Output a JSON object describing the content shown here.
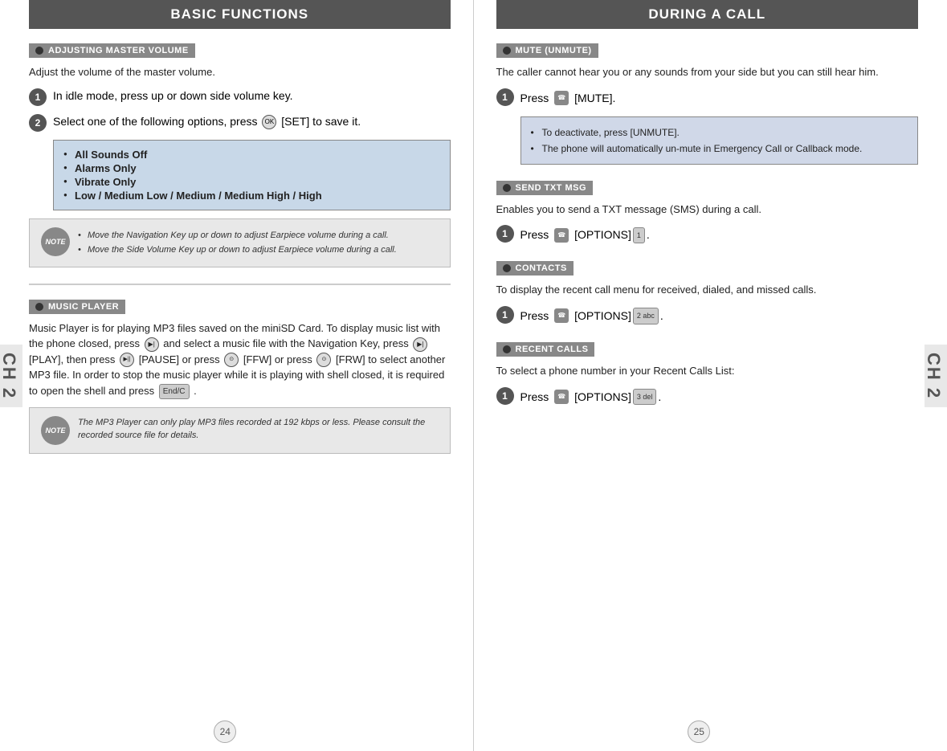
{
  "left": {
    "section_title": "BASIC FUNCTIONS",
    "ch_label": "CH 2",
    "page_number": "24",
    "adjusting_volume": {
      "header": "ADJUSTING MASTER VOLUME",
      "desc": "Adjust the volume of the master volume.",
      "step1": "In idle mode, press up or down side volume key.",
      "step2_prefix": "Select one of the following options, press",
      "step2_suffix": "[SET] to save it.",
      "options": [
        "All Sounds Off",
        "Alarms Only",
        "Vibrate Only",
        "Low / Medium Low / Medium / Medium High / High"
      ],
      "note_items": [
        "Move the Navigation Key up or down to adjust Earpiece volume during a call.",
        "Move the Side Volume Key up or down to adjust Earpiece volume during a call."
      ]
    },
    "music_player": {
      "header": "MUSIC PLAYER",
      "desc": "Music Player is for playing MP3 files saved on the miniSD Card. To display music list with the phone closed, press",
      "desc2": "and select a music file with the Navigation Key, press",
      "desc3": "[PLAY], then press",
      "desc4": "[PAUSE] or press",
      "desc5": "[FFW] or press",
      "desc6": "[FRW] to select another MP3 file. In order to stop the music player while it is playing with shell closed, it is required to open the shell and press",
      "desc7": ".",
      "note_text": "The MP3 Player can only play MP3 files recorded at 192 kbps or less. Please consult the recorded source file for details."
    }
  },
  "right": {
    "section_title": "DURING A CALL",
    "ch_label": "CH 2",
    "page_number": "25",
    "mute": {
      "header": "MUTE (UNMUTE)",
      "desc": "The caller cannot hear you or any sounds from your side but you can still hear him.",
      "step1_prefix": "Press",
      "step1_suffix": "[MUTE].",
      "info_items": [
        "To deactivate, press  [UNMUTE].",
        "The phone will automatically un-mute in Emergency Call or Callback mode."
      ]
    },
    "send_txt": {
      "header": "SEND TXT MSG",
      "desc": "Enables you to send a TXT message (SMS) during a call.",
      "step1_prefix": "Press",
      "step1_suffix": "[OPTIONS]"
    },
    "contacts": {
      "header": "CONTACTS",
      "desc": "To display the recent call menu for received, dialed, and missed calls.",
      "step1_prefix": "Press",
      "step1_suffix": "[OPTIONS]"
    },
    "recent_calls": {
      "header": "RECENT CALLS",
      "desc": "To select a phone number in your Recent Calls List:",
      "step1_prefix": "Press",
      "step1_suffix": "[OPTIONS]"
    }
  }
}
